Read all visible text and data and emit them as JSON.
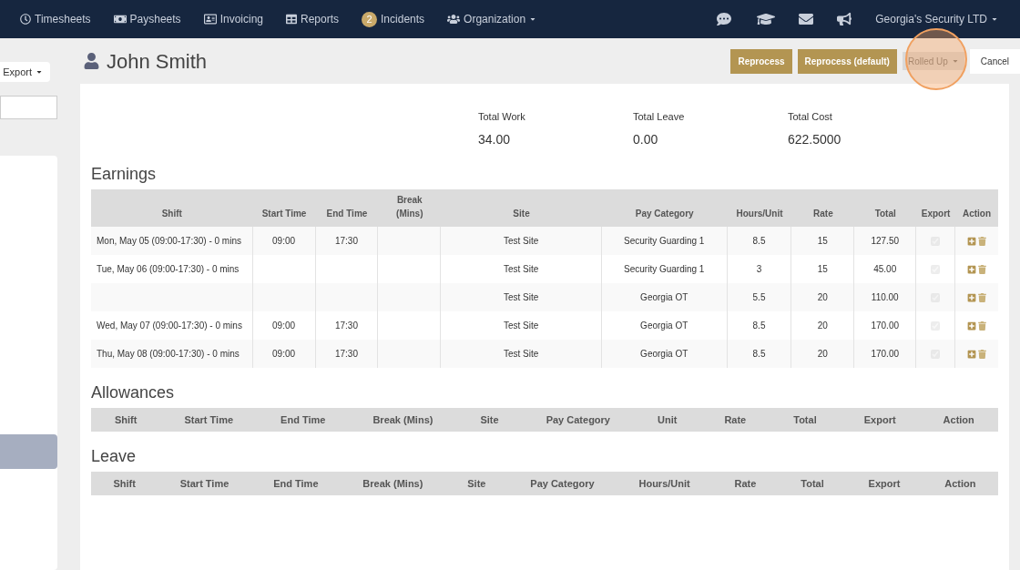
{
  "nav": {
    "items": [
      {
        "label": "Timesheets",
        "dropdown": false
      },
      {
        "label": "Paysheets",
        "dropdown": false
      },
      {
        "label": "Invoicing",
        "dropdown": false
      },
      {
        "label": "Reports",
        "dropdown": false
      },
      {
        "label": "Incidents",
        "badge": "2",
        "dropdown": false
      },
      {
        "label": "Organization",
        "dropdown": true
      }
    ],
    "account": "Georgia's Security LTD"
  },
  "sidebar": {
    "export_button": "Export"
  },
  "header": {
    "name": "John Smith",
    "buttons": [
      {
        "label": "Reprocess",
        "kind": "primary"
      },
      {
        "label": "Reprocess (default)",
        "kind": "primary"
      },
      {
        "label": "Rolled Up",
        "kind": "dropdown"
      },
      {
        "label": "Cancel",
        "kind": "plain"
      }
    ]
  },
  "totals": [
    {
      "label": "Total Work",
      "value": "34.00"
    },
    {
      "label": "Total Leave",
      "value": "0.00"
    },
    {
      "label": "Total Cost",
      "value": "622.5000"
    }
  ],
  "earnings": {
    "title": "Earnings",
    "columns": [
      "Shift",
      "Start Time",
      "End Time",
      "Break (Mins)",
      "Site",
      "Pay Category",
      "Hours/Unit",
      "Rate",
      "Total",
      "Export",
      "Action"
    ],
    "rows": [
      {
        "shift": "Mon, May 05 (09:00-17:30) - 0 mins",
        "start": "09:00",
        "end": "17:30",
        "break": "",
        "site": "Test Site",
        "category": "Security Guarding 1",
        "hours": "8.5",
        "rate": "15",
        "total": "127.50",
        "export": true
      },
      {
        "shift": "Tue, May 06 (09:00-17:30) - 0 mins",
        "start": "",
        "end": "",
        "break": "",
        "site": "Test Site",
        "category": "Security Guarding 1",
        "hours": "3",
        "rate": "15",
        "total": "45.00",
        "export": true
      },
      {
        "shift": "",
        "start": "",
        "end": "",
        "break": "",
        "site": "Test Site",
        "category": "Georgia OT",
        "hours": "5.5",
        "rate": "20",
        "total": "110.00",
        "export": true
      },
      {
        "shift": "Wed, May 07 (09:00-17:30) - 0 mins",
        "start": "09:00",
        "end": "17:30",
        "break": "",
        "site": "Test Site",
        "category": "Georgia OT",
        "hours": "8.5",
        "rate": "20",
        "total": "170.00",
        "export": true
      },
      {
        "shift": "Thu, May 08 (09:00-17:30) - 0 mins",
        "start": "09:00",
        "end": "17:30",
        "break": "",
        "site": "Test Site",
        "category": "Georgia OT",
        "hours": "8.5",
        "rate": "20",
        "total": "170.00",
        "export": true
      }
    ]
  },
  "allowances": {
    "title": "Allowances",
    "columns": [
      "Shift",
      "Start Time",
      "End Time",
      "Break (Mins)",
      "Site",
      "Pay Category",
      "Unit",
      "Rate",
      "Total",
      "Export",
      "Action"
    ]
  },
  "leave": {
    "title": "Leave",
    "columns": [
      "Shift",
      "Start Time",
      "End Time",
      "Break (Mins)",
      "Site",
      "Pay Category",
      "Hours/Unit",
      "Rate",
      "Total",
      "Export",
      "Action"
    ]
  }
}
